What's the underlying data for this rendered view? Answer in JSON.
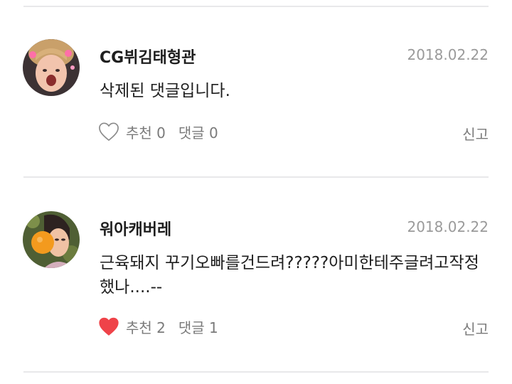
{
  "comments": [
    {
      "username": "CG뷔김태형관",
      "date": "2018.02.22",
      "body": "삭제된 댓글입니다.",
      "like_label": "추천 0",
      "reply_label": "댓글 0",
      "report_label": "신고",
      "liked": false,
      "avatar_icon": "user-photo-avatar"
    },
    {
      "username": "워아캐버레",
      "date": "2018.02.22",
      "body": "근육돼지 꾸기오빠를건드려?????아미한테주글려고작정했나....--",
      "like_label": "추천 2",
      "reply_label": "댓글 1",
      "report_label": "신고",
      "liked": true,
      "avatar_icon": "user-photo-avatar"
    }
  ],
  "colors": {
    "heart_liked": "#ef4349",
    "heart_outline": "#8a8a8a",
    "meta_text": "#9a9a9a",
    "divider": "#e8e8ea"
  }
}
